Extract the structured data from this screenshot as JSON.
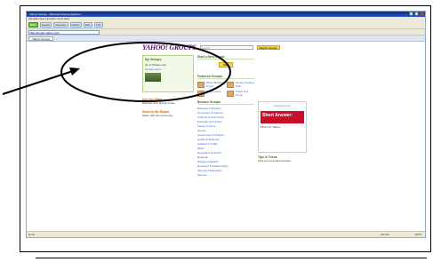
{
  "browser": {
    "title": "Yahoo! Groups - Microsoft Internet Explorer",
    "menu": "File  Edit  View  Favorites  Tools  Help",
    "toolbar_buttons": [
      "Search",
      "Favorites",
      "History",
      "Mail",
      "Print"
    ],
    "back_label": "Back",
    "address": "http://groups.yahoo.com/",
    "tab_label": "Yahoo! Groups",
    "status_text": "Done",
    "status_zone": "Internet",
    "zoom": "100%"
  },
  "yahoo": {
    "logo": "YAHOO! GROUPS",
    "search_placeholder": "Search",
    "search_button": "Search Groups",
    "top_links": "Sign In  New User?",
    "my_groups": {
      "title": "My Groups",
      "text": "Go to Photos.com",
      "link": "Groups Home"
    },
    "side_blocks": [
      {
        "title": "See the Stars",
        "text": "Discover new groups to join"
      },
      {
        "title": "Send to the Board",
        "text": "Share with the community"
      }
    ],
    "start_group": {
      "title": "Start a New Group",
      "button": "Start"
    },
    "featured": {
      "title": "Featured Groups",
      "items": [
        "Photo Sharing Group",
        "Family Cooking Club",
        "Book Lovers",
        "Travel Tips Group"
      ]
    },
    "browse": {
      "title": "Browse Groups",
      "items": [
        "Business & Finance",
        "Computers & Internet",
        "Cultures & Community",
        "Entertainment & Arts",
        "Family & Home",
        "Games",
        "Government & Politics",
        "Health & Wellness",
        "Hobbies & Crafts",
        "Music",
        "Recreation & Sports",
        "Regional",
        "Religion & Beliefs",
        "Romance & Relationships",
        "Schools & Education",
        "Science"
      ]
    },
    "ad": {
      "label": "Advertisement",
      "headline": "Short Answer:",
      "sub": "Find it on Yahoo!"
    },
    "tips": {
      "title": "Tips & Tricks",
      "text": "Find out more about groups"
    }
  }
}
